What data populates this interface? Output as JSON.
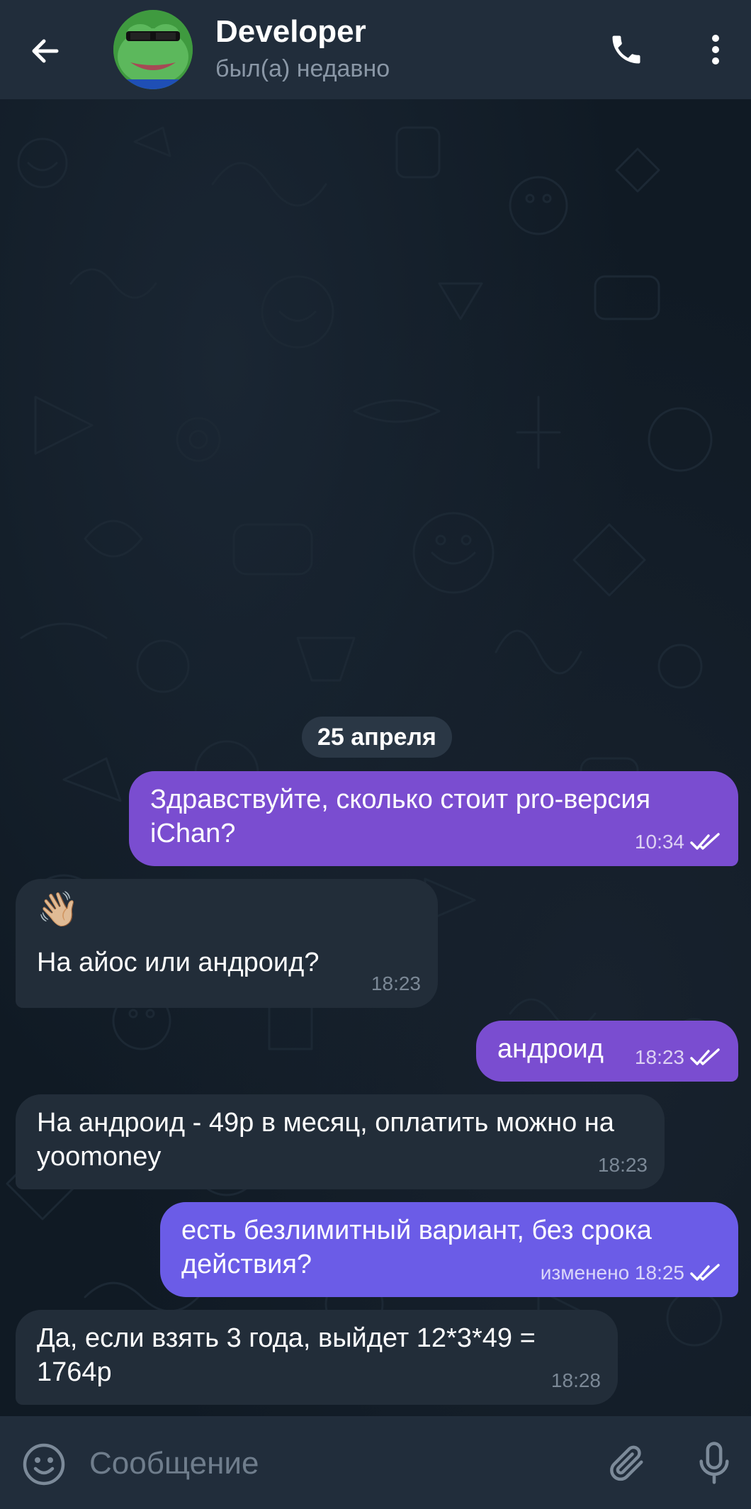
{
  "header": {
    "title": "Developer",
    "status": "был(а) недавно"
  },
  "date_chip": "25 апреля",
  "messages": [
    {
      "direction": "out",
      "text": "Здравствуйте, сколько стоит pro-версия iChan?",
      "time": "10:34",
      "read": true
    },
    {
      "direction": "in",
      "emoji": "👋🏼",
      "text": "На айос или андроид?",
      "time": "18:23"
    },
    {
      "direction": "out",
      "text": "андроид",
      "time": "18:23",
      "read": true
    },
    {
      "direction": "in",
      "text": "На андроид - 49р в месяц, оплатить можно на yoomoney",
      "time": "18:23"
    },
    {
      "direction": "out",
      "text": "есть безлимитный вариант, без срока действия?",
      "time": "изменено 18:25",
      "read": true
    },
    {
      "direction": "in",
      "text": "Да, если взять 3 года, выйдет 12*3*49 = 1764р",
      "time": "18:28"
    }
  ],
  "input": {
    "placeholder": "Сообщение"
  },
  "colors": {
    "header_bg": "#212d3b",
    "outgoing_bubble": "#7a4dd0",
    "outgoing_bubble_alt": "#6b5ce7",
    "incoming_bubble": "#222d39",
    "secondary_text": "#8a97a6"
  },
  "icons": {
    "back": "arrow-left-icon",
    "call": "phone-icon",
    "menu": "more-vertical-icon",
    "emoji": "smiley-icon",
    "attach": "paperclip-icon",
    "mic": "microphone-icon",
    "read_receipt": "double-check-icon"
  }
}
